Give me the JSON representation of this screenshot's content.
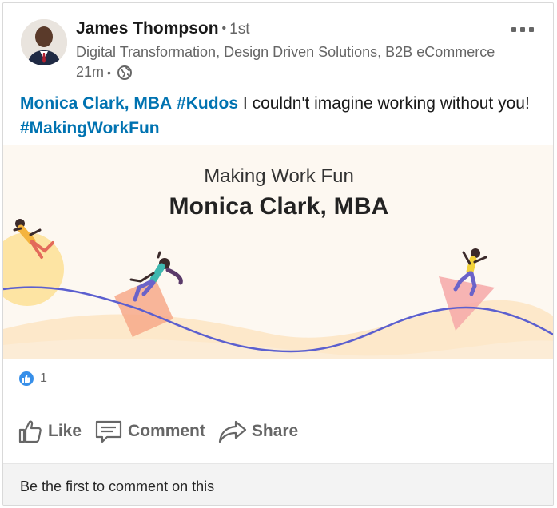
{
  "post": {
    "author": {
      "name": "James Thompson",
      "degree": "1st",
      "headline": "Digital Transformation, Design Driven Solutions, B2B eCommerce",
      "time": "21m"
    },
    "text": {
      "mention": "Monica Clark, MBA",
      "hashtag1": "#Kudos",
      "body": "I couldn't imagine working without you!",
      "hashtag2": "#MakingWorkFun"
    },
    "banner": {
      "title": "Making Work Fun",
      "name": "Monica Clark, MBA"
    },
    "reactions": {
      "count": "1"
    },
    "actions": {
      "like": "Like",
      "comment": "Comment",
      "share": "Share"
    },
    "comment_prompt": "Be the first to comment on this"
  },
  "colors": {
    "link": "#0073b1",
    "like_badge": "#378fe9",
    "action_gray": "#666666",
    "wave_line": "#5b5fcf",
    "banner_bg": "#fdf8f1"
  },
  "icons": [
    "more-icon",
    "globe-icon",
    "like-badge-icon",
    "like-icon",
    "comment-icon",
    "share-icon"
  ]
}
